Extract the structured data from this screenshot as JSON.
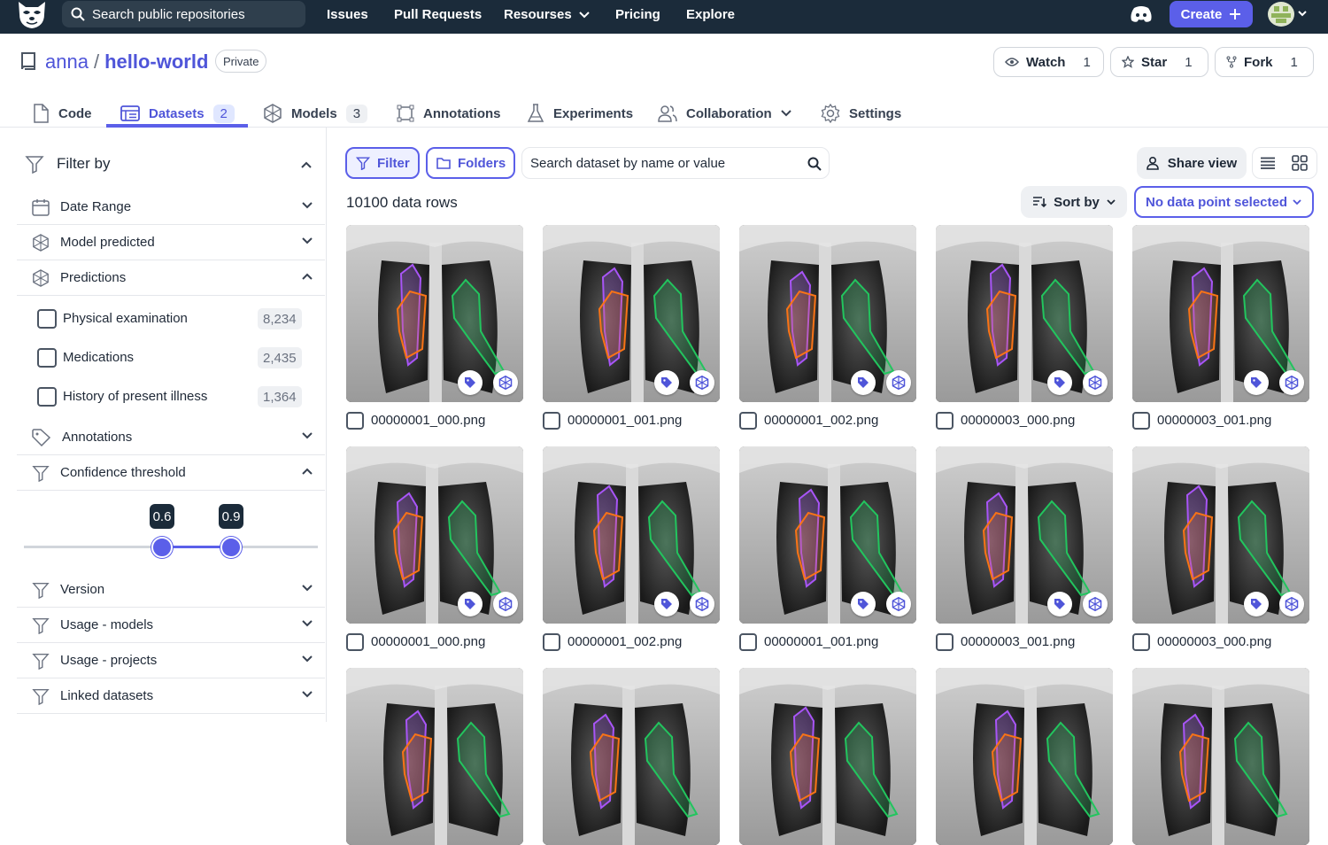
{
  "topnav": {
    "search_placeholder": "Search public repositories",
    "links": [
      "Issues",
      "Pull Requests",
      "Resourses",
      "Pricing",
      "Explore"
    ],
    "create_label": "Create"
  },
  "repo": {
    "owner": "anna",
    "separator": "/",
    "name": "hello-world",
    "visibility": "Private",
    "watch": {
      "label": "Watch",
      "count": "1"
    },
    "star": {
      "label": "Star",
      "count": "1"
    },
    "fork": {
      "label": "Fork",
      "count": "1"
    }
  },
  "tabs": [
    {
      "label": "Code",
      "count": ""
    },
    {
      "label": "Datasets",
      "count": "2"
    },
    {
      "label": "Models",
      "count": "3"
    },
    {
      "label": "Annotations",
      "count": ""
    },
    {
      "label": "Experiments",
      "count": ""
    },
    {
      "label": "Collaboration",
      "count": ""
    },
    {
      "label": "Settings",
      "count": ""
    }
  ],
  "sidebar": {
    "title": "Filter by",
    "sections": [
      "Date Range",
      "Model predicted",
      "Predictions",
      "Annotations",
      "Confidence threshold",
      "Version",
      "Usage - models",
      "Usage - projects",
      "Linked datasets"
    ],
    "predictions": [
      {
        "label": "Physical examination",
        "count": "8,234"
      },
      {
        "label": "Medications",
        "count": "2,435"
      },
      {
        "label": "History of present illness",
        "count": "1,364"
      }
    ],
    "confidence": {
      "low": "0.6",
      "high": "0.9",
      "low_value": 0.6,
      "high_value": 0.9
    }
  },
  "toolbar": {
    "filter_label": "Filter",
    "folders_label": "Folders",
    "search_placeholder": "Search dataset by name or value",
    "share_label": "Share view",
    "sort_label": "Sort by",
    "datapoint_label": "No data point selected",
    "row_count": "10100 data rows"
  },
  "grid": {
    "row1": [
      "00000001_000.png",
      "00000001_001.png",
      "00000001_002.png",
      "00000003_000.png",
      "00000003_001.png"
    ],
    "row2": [
      "00000001_000.png",
      "00000001_002.png",
      "00000001_001.png",
      "00000003_001.png",
      "00000003_000.png"
    ]
  },
  "colors": {
    "accent": "#5b5fe9",
    "nav_bg": "#1b2b3a",
    "overlay_purple": "#a855f7",
    "overlay_orange": "#f97316",
    "overlay_green": "#22c55e"
  }
}
